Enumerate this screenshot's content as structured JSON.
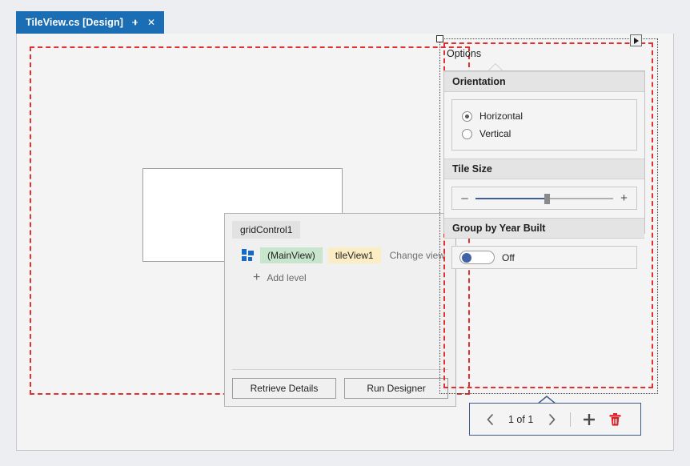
{
  "tab": {
    "title": "TileView.cs [Design]",
    "pin_icon": "pin-icon",
    "close_label": "✕"
  },
  "designer": {
    "grid_control_placeholder": ""
  },
  "smart_tag": {
    "title": "gridControl1",
    "view_icon": "grid-levels-icon",
    "main_view_label": "(MainView)",
    "tile_view_label": "tileView1",
    "change_view_label": "Change view",
    "add_level_label": "Add level",
    "add_level_icon": "plus-icon",
    "retrieve_details_label": "Retrieve Details",
    "run_designer_label": "Run Designer"
  },
  "options_panel": {
    "label": "Options",
    "smart_tag_glyph": "smart-tag-arrow-icon",
    "orientation": {
      "header": "Orientation",
      "options": [
        {
          "label": "Horizontal",
          "selected": true
        },
        {
          "label": "Vertical",
          "selected": false
        }
      ]
    },
    "tile_size": {
      "header": "Tile Size",
      "minus_label": "–",
      "plus_label": "+",
      "value_percent": 52
    },
    "group_by": {
      "header": "Group by Year Built",
      "toggle_state": "Off"
    }
  },
  "nav_toolbar": {
    "prev_icon": "chevron-left-icon",
    "next_icon": "chevron-right-icon",
    "page_text": "1 of 1",
    "add_icon": "plus-icon",
    "delete_icon": "trash-icon"
  },
  "colors": {
    "tab_active": "#1c6eb4",
    "bounds_dashed": "#e03030",
    "accent_blue": "#3f5e9c",
    "chip_main": "#c8e6cd",
    "chip_view": "#fdedc4",
    "trash_red": "#e01f28"
  }
}
